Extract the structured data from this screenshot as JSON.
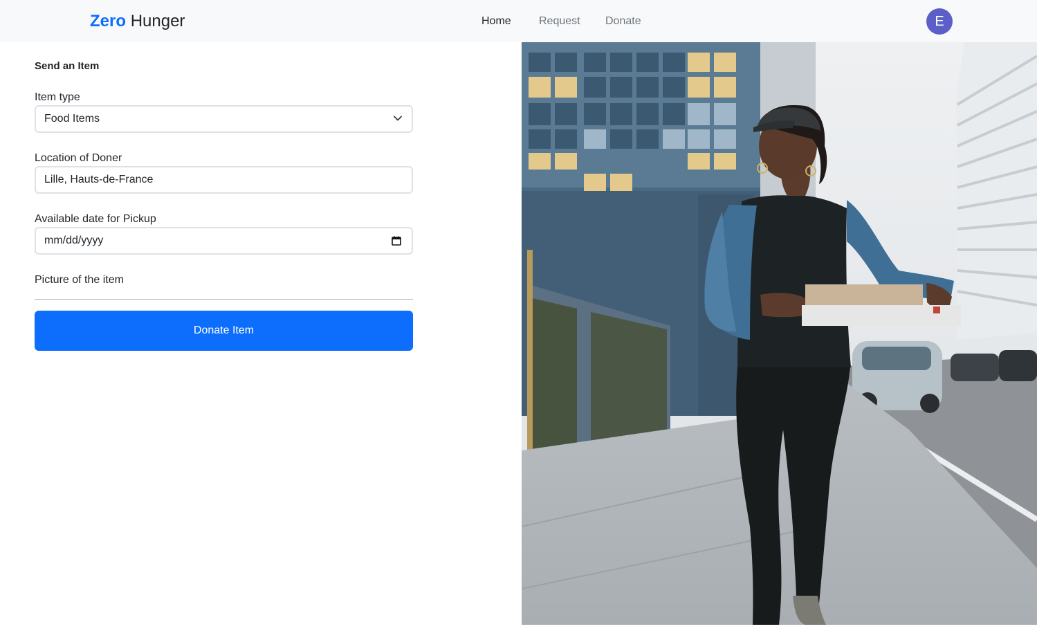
{
  "navbar": {
    "brand_part1": "Zero",
    "brand_part2": "Hunger",
    "links": [
      {
        "label": "Home",
        "active": true
      },
      {
        "label": "Request",
        "active": false
      },
      {
        "label": "Donate",
        "active": false
      }
    ],
    "avatar_initial": "E"
  },
  "form": {
    "title": "Send an Item",
    "item_type": {
      "label": "Item type",
      "value": "Food Items"
    },
    "location": {
      "label": "Location of Doner",
      "value": "Lille, Hauts-de-France"
    },
    "pickup_date": {
      "label": "Available date for Pickup",
      "value": "mm/dd/yyyy"
    },
    "picture": {
      "label": "Picture of the item"
    },
    "submit_label": "Donate Item"
  },
  "colors": {
    "brand": "#0d6efd",
    "navbar_bg": "#f8f9fa",
    "avatar_bg": "#5b5fc7",
    "button_bg": "#0d6efd"
  }
}
